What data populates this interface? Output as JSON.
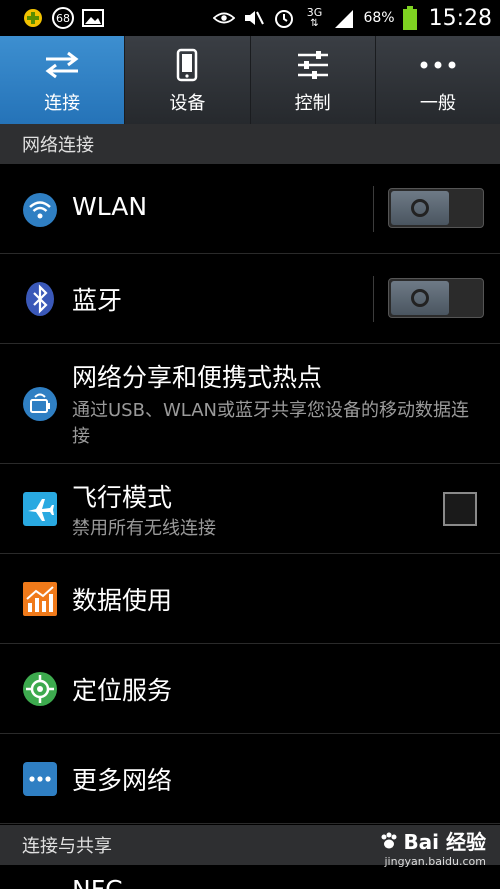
{
  "status_bar": {
    "left_icons": [
      "app-icon",
      "badge-68-icon",
      "picture-icon"
    ],
    "badge_number": "68",
    "right_icons": [
      "eye-icon",
      "mute-icon",
      "alarm-icon",
      "network-3g-icon",
      "signal-icon"
    ],
    "network": "3G",
    "battery_percent": "68%",
    "time": "15:28"
  },
  "tabs": [
    {
      "label": "连接",
      "icon": "connections-icon",
      "active": true
    },
    {
      "label": "设备",
      "icon": "device-icon",
      "active": false
    },
    {
      "label": "控制",
      "icon": "sliders-icon",
      "active": false
    },
    {
      "label": "一般",
      "icon": "more-dots-icon",
      "active": false
    }
  ],
  "sections": {
    "network": "网络连接",
    "sharing": "连接与共享"
  },
  "items": {
    "wlan": {
      "title": "WLAN",
      "toggle": "off"
    },
    "bluetooth": {
      "title": "蓝牙",
      "toggle": "off"
    },
    "tethering": {
      "title": "网络分享和便携式热点",
      "subtitle": "通过USB、WLAN或蓝牙共享您设备的移动数据连接"
    },
    "airplane": {
      "title": "飞行模式",
      "subtitle": "禁用所有无线连接",
      "checked": false
    },
    "data_usage": {
      "title": "数据使用"
    },
    "location": {
      "title": "定位服务"
    },
    "more_networks": {
      "title": "更多网络"
    },
    "nfc": {
      "title": "NFC"
    }
  },
  "watermark": {
    "text": "Bai 经验",
    "url": "jingyan.baidu.com"
  },
  "colors": {
    "accent": "#2f7fc3",
    "background": "#000000",
    "section_bg": "#2e2f31"
  }
}
